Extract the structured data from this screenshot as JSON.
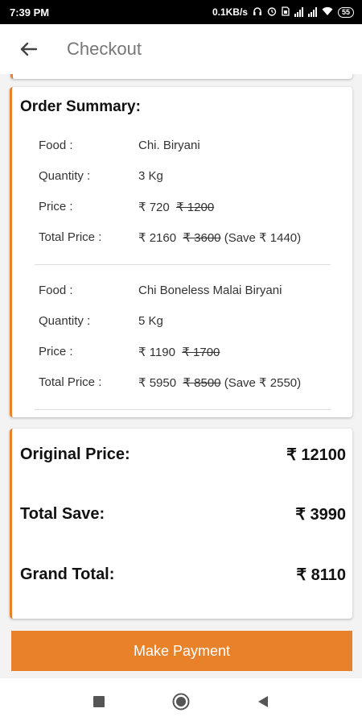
{
  "status_bar": {
    "time": "7:39 PM",
    "net_speed": "0.1KB/s",
    "battery": "55"
  },
  "app_bar": {
    "title": "Checkout",
    "back_icon": "arrow-left-icon"
  },
  "order_summary": {
    "title": "Order Summary:",
    "items": [
      {
        "food_label": "Food :",
        "food": "Chi. Biryani",
        "quantity_label": "Quantity :",
        "quantity": "3 Kg",
        "price_label": "Price :",
        "price": "₹ 720",
        "price_original": "₹ 1200",
        "total_label": "Total Price :",
        "total": "₹ 2160",
        "total_original": "₹ 3600",
        "save": "(Save ₹ 1440)"
      },
      {
        "food_label": "Food :",
        "food": "Chi Boneless Malai Biryani",
        "quantity_label": "Quantity :",
        "quantity": "5 Kg",
        "price_label": "Price :",
        "price": "₹ 1190",
        "price_original": "₹ 1700",
        "total_label": "Total Price :",
        "total": "₹ 5950",
        "total_original": "₹ 8500",
        "save": "(Save ₹ 2550)"
      }
    ]
  },
  "totals": {
    "original_label": "Original Price:",
    "original_value": "₹ 12100",
    "save_label": "Total Save:",
    "save_value": "₹ 3990",
    "grand_label": "Grand Total:",
    "grand_value": "₹ 8110"
  },
  "payment_button": "Make Payment",
  "colors": {
    "accent": "#e8822a",
    "status_bar": "#000000"
  },
  "nav_bar": {
    "icons": [
      "recents-square-icon",
      "home-circle-icon",
      "back-triangle-icon"
    ]
  }
}
